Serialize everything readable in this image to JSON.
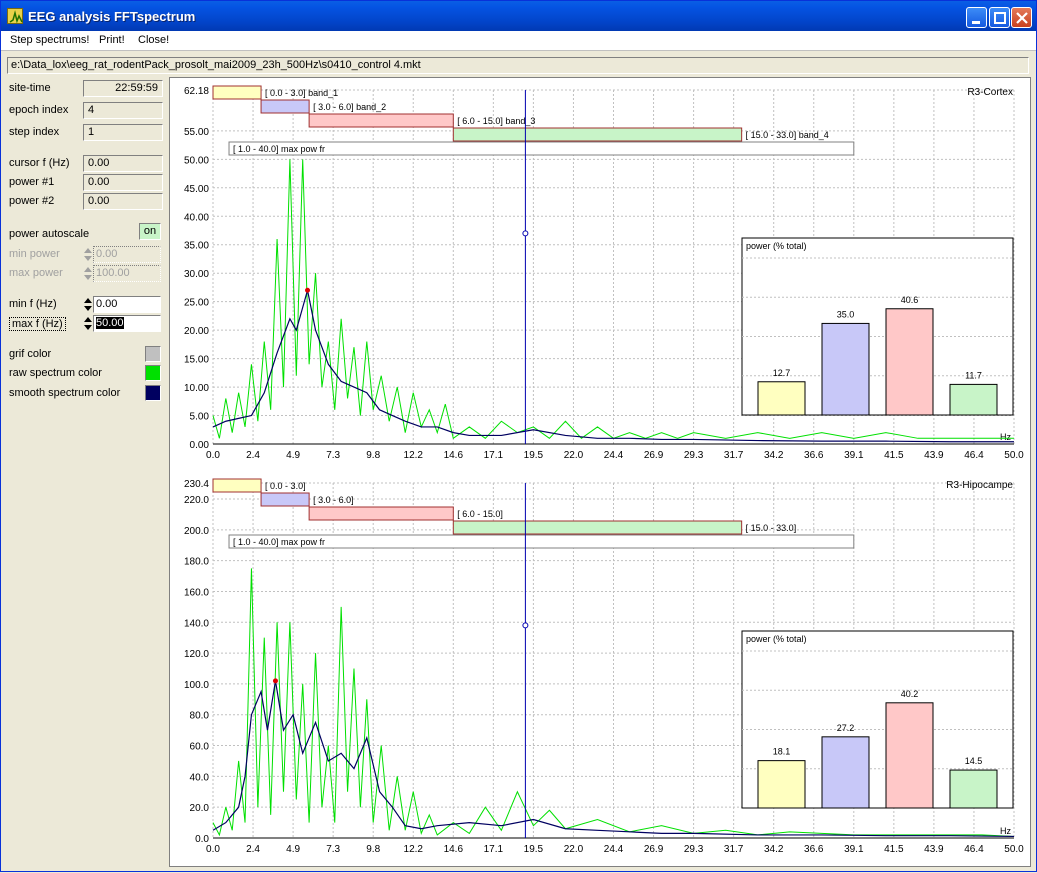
{
  "window": {
    "title": "EEG analysis FFTspectrum"
  },
  "menu": [
    "Step spectrums!",
    "Print!",
    "Close!"
  ],
  "file_path": "e:\\Data_lox\\eeg_rat_rodentPack_prosolt_mai2009_23h_500Hz\\s0410_control 4.mkt",
  "left_panel": {
    "site_time_label": "site-time",
    "site_time": "22:59:59",
    "epoch_index_label": "epoch index",
    "epoch_index": "4",
    "step_index_label": "step index",
    "step_index": "1",
    "cursor_f_label": "cursor f (Hz)",
    "cursor_f": "0.00",
    "power1_label": "power #1",
    "power1": "0.00",
    "power2_label": "power #2",
    "power2": "0.00",
    "power_autoscale_label": "power autoscale",
    "power_autoscale": "on",
    "min_power_label": "min power",
    "min_power": "0.00",
    "max_power_label": "max power",
    "max_power": "100.00",
    "min_f_label": "min f (Hz)",
    "min_f": "0.00",
    "max_f_label": "max f (Hz)",
    "max_f": "50.00",
    "grid_color_label": "grif color",
    "raw_color_label": "raw spectrum color",
    "smooth_color_label": "smooth spectrum color"
  },
  "colors": {
    "grid": "#c0c0c0",
    "raw": "#00e000",
    "smooth": "#000060",
    "cursor": "#0000b0",
    "peak": "#e00000",
    "band_1": "#ffffc0",
    "band_2": "#c8c8f8",
    "band_3": "#ffc8c8",
    "band_4": "#c8f4c8"
  },
  "x_axis": {
    "ticks": [
      "0.0",
      "2.4",
      "4.9",
      "7.3",
      "9.8",
      "12.2",
      "14.6",
      "17.1",
      "19.5",
      "22.0",
      "24.4",
      "26.9",
      "29.3",
      "31.7",
      "34.2",
      "36.6",
      "39.1",
      "41.5",
      "43.9",
      "46.4",
      "50.0"
    ],
    "unit": "Hz"
  },
  "cursor_hz": 19.5,
  "chart_data": [
    {
      "type": "line",
      "title": "R3-Cortex",
      "x_unit": "Hz",
      "xlim": [
        0,
        50
      ],
      "ylim": [
        0,
        62.18
      ],
      "y_ticks": [
        "0.00",
        "5.00",
        "10.00",
        "15.00",
        "20.00",
        "25.00",
        "30.00",
        "35.00",
        "40.00",
        "45.00",
        "50.00",
        "55.00",
        "62.18"
      ],
      "bands": [
        {
          "label": "[  0.0 -  3.0] band_1",
          "start": 0.0,
          "end": 3.0
        },
        {
          "label": "[  3.0 -  6.0] band_2",
          "start": 3.0,
          "end": 6.0
        },
        {
          "label": "[  6.0 - 15.0] band_3",
          "start": 6.0,
          "end": 15.0
        },
        {
          "label": "[ 15.0 - 33.0] band_4",
          "start": 15.0,
          "end": 33.0
        },
        {
          "label": "[  1.0 - 40.0] max pow fr",
          "start": 1.0,
          "end": 40.0
        }
      ],
      "peak": {
        "x": 5.9,
        "y": 27.0
      },
      "cursor_y": 37.0,
      "series": [
        {
          "name": "raw",
          "x": [
            0,
            0.4,
            0.8,
            1.2,
            1.6,
            2.0,
            2.4,
            2.8,
            3.2,
            3.6,
            4.0,
            4.4,
            4.8,
            5.2,
            5.6,
            6.0,
            6.4,
            6.8,
            7.2,
            7.6,
            8.0,
            8.4,
            8.8,
            9.2,
            9.6,
            10,
            10.5,
            11,
            11.5,
            12,
            12.5,
            13,
            13.5,
            14,
            14.5,
            15,
            16,
            17,
            18,
            19,
            20,
            21,
            22,
            23,
            24,
            25,
            26,
            27,
            28,
            29,
            30,
            32,
            34,
            36,
            38,
            40,
            42,
            44,
            46,
            48,
            50
          ],
          "y": [
            5,
            1,
            8,
            2,
            9,
            3,
            14,
            4,
            18,
            6,
            36,
            10,
            50,
            12,
            50,
            14,
            30,
            10,
            18,
            6,
            22,
            8,
            17,
            5,
            18,
            6,
            12,
            4,
            10,
            2,
            9,
            3,
            6,
            2,
            7,
            1,
            3,
            1,
            4,
            2,
            3,
            1,
            4,
            1,
            3,
            1,
            2,
            1,
            2,
            1,
            2,
            1,
            2,
            1,
            2,
            1,
            2,
            1,
            1,
            1,
            1
          ]
        },
        {
          "name": "smooth",
          "x": [
            0,
            0.8,
            1.6,
            2.4,
            3.2,
            4.0,
            4.8,
            5.2,
            5.6,
            5.9,
            6.4,
            7.2,
            8.0,
            8.8,
            9.6,
            10.4,
            11.2,
            12,
            13,
            14,
            15,
            16,
            18,
            20,
            22,
            24,
            26,
            28,
            30,
            34,
            38,
            42,
            46,
            50
          ],
          "y": [
            3,
            4,
            4.5,
            5,
            9,
            16,
            22,
            20,
            24,
            27,
            20,
            14,
            11,
            10,
            9,
            6,
            5,
            4,
            3,
            3,
            2,
            1.5,
            1.5,
            2.5,
            1.5,
            1,
            1,
            0.8,
            0.8,
            0.6,
            0.5,
            0.5,
            0.4,
            0.4
          ]
        }
      ],
      "inset": {
        "title": "power (% total)",
        "values": [
          12.7,
          35.0,
          40.6,
          11.7
        ],
        "labels": [
          "12.7",
          "35.0",
          "40.6",
          "11.7"
        ]
      }
    },
    {
      "type": "line",
      "title": "R3-Hipocampe",
      "x_unit": "Hz",
      "xlim": [
        0,
        50
      ],
      "ylim": [
        0,
        230.4
      ],
      "y_ticks": [
        "0.0",
        "20.0",
        "40.0",
        "60.0",
        "80.0",
        "100.0",
        "120.0",
        "140.0",
        "160.0",
        "180.0",
        "200.0",
        "220.0",
        "230.4"
      ],
      "bands": [
        {
          "label": "[  0.0 -  3.0]",
          "start": 0.0,
          "end": 3.0
        },
        {
          "label": "[  3.0 -  6.0]",
          "start": 3.0,
          "end": 6.0
        },
        {
          "label": "[  6.0 - 15.0]",
          "start": 6.0,
          "end": 15.0
        },
        {
          "label": "[ 15.0 - 33.0]",
          "start": 15.0,
          "end": 33.0
        },
        {
          "label": "[  1.0 - 40.0] max pow fr",
          "start": 1.0,
          "end": 40.0
        }
      ],
      "peak": {
        "x": 3.9,
        "y": 102.0
      },
      "cursor_y": 138.0,
      "series": [
        {
          "name": "raw",
          "x": [
            0,
            0.4,
            0.8,
            1.2,
            1.6,
            2.0,
            2.4,
            2.8,
            3.2,
            3.6,
            4.0,
            4.4,
            4.8,
            5.2,
            5.6,
            6.0,
            6.4,
            6.8,
            7.2,
            7.6,
            8.0,
            8.4,
            8.8,
            9.2,
            9.6,
            10,
            10.5,
            11,
            11.5,
            12,
            12.5,
            13,
            13.5,
            14,
            15,
            16,
            17,
            18,
            19,
            20,
            21,
            22,
            24,
            26,
            28,
            30,
            32,
            34,
            36,
            40,
            44,
            48,
            50
          ],
          "y": [
            10,
            2,
            20,
            5,
            50,
            10,
            175,
            20,
            130,
            15,
            140,
            30,
            140,
            25,
            100,
            10,
            120,
            20,
            60,
            10,
            150,
            30,
            110,
            20,
            90,
            10,
            60,
            5,
            40,
            5,
            30,
            3,
            15,
            2,
            10,
            3,
            20,
            5,
            30,
            8,
            18,
            6,
            12,
            4,
            8,
            3,
            5,
            2,
            4,
            2,
            2,
            2,
            1
          ]
        },
        {
          "name": "smooth",
          "x": [
            0,
            0.8,
            1.6,
            2.0,
            2.4,
            3.0,
            3.4,
            3.9,
            4.4,
            5.0,
            5.6,
            6.4,
            7.2,
            8.0,
            8.8,
            9.6,
            10.4,
            11.2,
            12,
            13,
            14,
            16,
            18,
            20,
            22,
            24,
            26,
            28,
            30,
            34,
            38,
            42,
            46,
            50
          ],
          "y": [
            5,
            10,
            20,
            40,
            80,
            95,
            70,
            102,
            70,
            80,
            55,
            75,
            50,
            55,
            45,
            65,
            30,
            20,
            8,
            6,
            8,
            10,
            8,
            12,
            6,
            5,
            4,
            3,
            3,
            2,
            2,
            1.5,
            1.5,
            1
          ]
        }
      ],
      "inset": {
        "title": "power (% total)",
        "values": [
          18.1,
          27.2,
          40.2,
          14.5
        ],
        "labels": [
          "18.1",
          "27.2",
          "40.2",
          "14.5"
        ]
      }
    }
  ]
}
